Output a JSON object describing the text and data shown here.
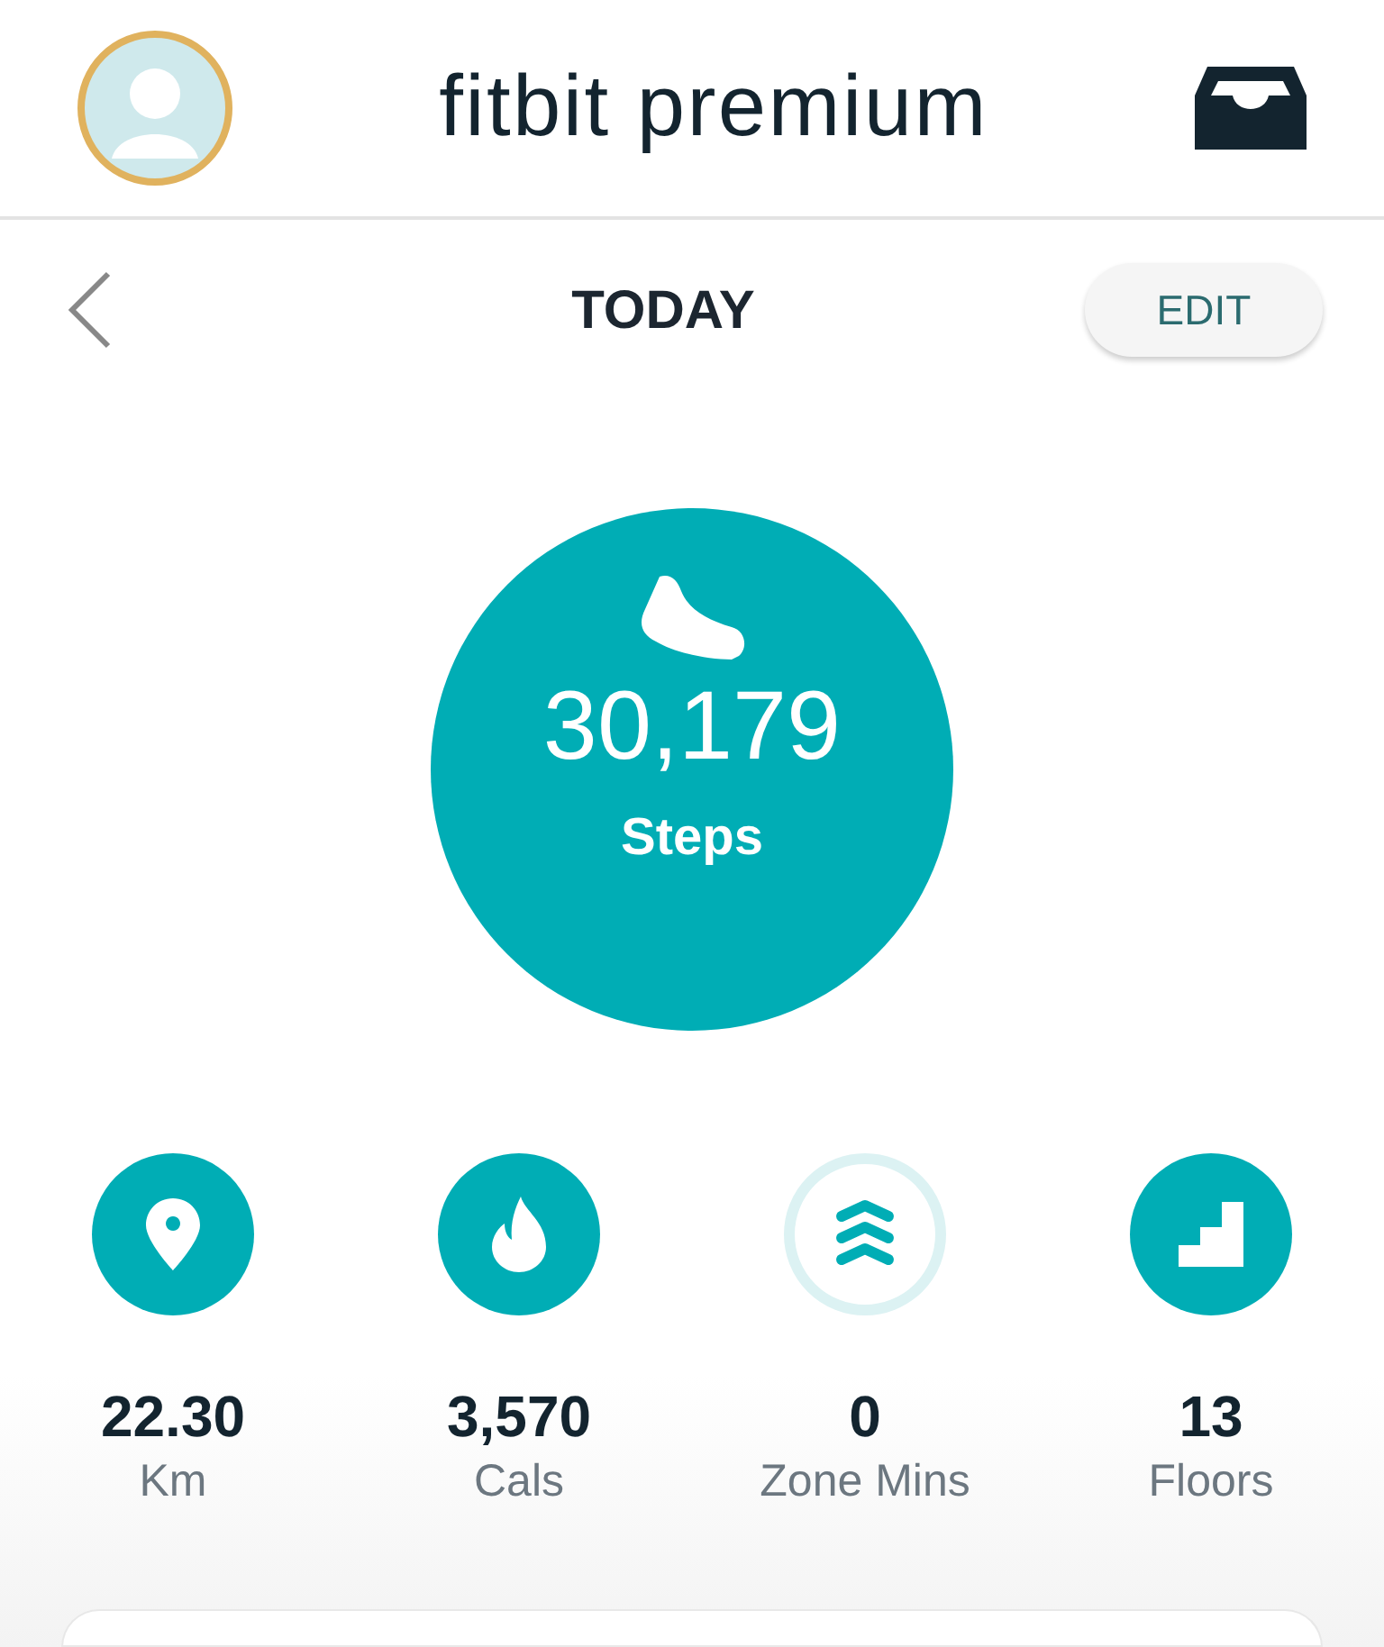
{
  "header": {
    "title": "fitbit premium"
  },
  "nav": {
    "title": "TODAY",
    "edit_button": "EDIT"
  },
  "steps": {
    "value": "30,179",
    "label": "Steps",
    "goal_met": true
  },
  "stats": [
    {
      "kind": "distance",
      "value": "22.30",
      "label": "Km",
      "goal_met": true
    },
    {
      "kind": "calories",
      "value": "3,570",
      "label": "Cals",
      "goal_met": true
    },
    {
      "kind": "zone",
      "value": "0",
      "label": "Zone Mins",
      "goal_met": false
    },
    {
      "kind": "floors",
      "value": "13",
      "label": "Floors",
      "goal_met": true
    }
  ]
}
